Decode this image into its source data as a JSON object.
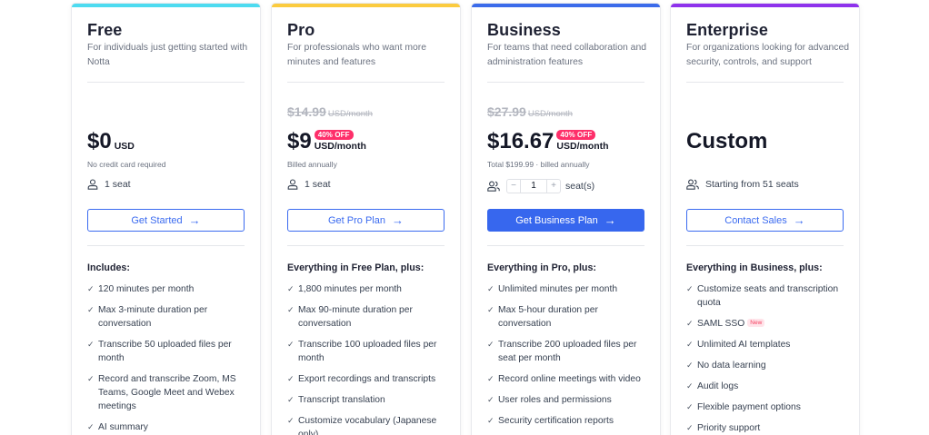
{
  "colors": {
    "free_accent": "#4ddbf0",
    "pro_accent": "#fbcb3f",
    "business_accent": "#3b6bea",
    "enterprise_accent": "#8e32ec",
    "cta_blue": "#3767ee",
    "badge_pink": "#fe2f6a"
  },
  "plans": {
    "free": {
      "name": "Free",
      "description": "For individuals just getting started with Notta",
      "price": "$0",
      "price_unit": "USD",
      "note": "No credit card required",
      "seats": "1 seat",
      "cta": "Get Started",
      "includes_title": "Includes:",
      "features": [
        "120 minutes per month",
        "Max 3-minute duration per conversation",
        "Transcribe 50 uploaded files per month",
        "Record and transcribe Zoom, MS Teams, Google Meet and Webex meetings",
        "AI summary"
      ]
    },
    "pro": {
      "name": "Pro",
      "description": "For professionals who want more minutes and features",
      "old_price": "$14.99",
      "old_price_unit": "USD/month",
      "discount": "40% OFF",
      "price": "$9",
      "price_unit": "USD/month",
      "note": "Billed annually",
      "seats": "1 seat",
      "cta": "Get Pro Plan",
      "includes_title": "Everything in Free Plan, plus:",
      "features": [
        "1,800 minutes per month",
        "Max 90-minute duration per conversation",
        "Transcribe 100 uploaded files per month",
        "Export recordings and transcripts",
        "Transcript translation",
        "Customize vocabulary (Japanese only)"
      ]
    },
    "business": {
      "name": "Business",
      "description": "For teams that need collaboration and administration features",
      "old_price": "$27.99",
      "old_price_unit": "USD/month",
      "discount": "40% OFF",
      "price": "$16.67",
      "price_unit": "USD/month",
      "note": "Total $199.99 · billed annually",
      "stepper": {
        "minus": "−",
        "value": "1",
        "plus": "+",
        "label": "seat(s)"
      },
      "cta": "Get Business Plan",
      "includes_title": "Everything in Pro, plus:",
      "features": [
        "Unlimited minutes per month",
        "Max 5-hour duration per conversation",
        "Transcribe 200 uploaded files per seat per month",
        "Record online meetings with video",
        "User roles and permissions",
        "Security certification reports"
      ]
    },
    "enterprise": {
      "name": "Enterprise",
      "description": "For organizations looking for advanced security, controls, and support",
      "price": "Custom",
      "seats": "Starting from 51 seats",
      "cta": "Contact Sales",
      "includes_title": "Everything in Business, plus:",
      "new_label": "New",
      "features": [
        "Customize seats and transcription quota",
        "SAML SSO",
        "Unlimited AI templates",
        "No data learning",
        "Audit logs",
        "Flexible payment options",
        "Priority support"
      ]
    }
  }
}
